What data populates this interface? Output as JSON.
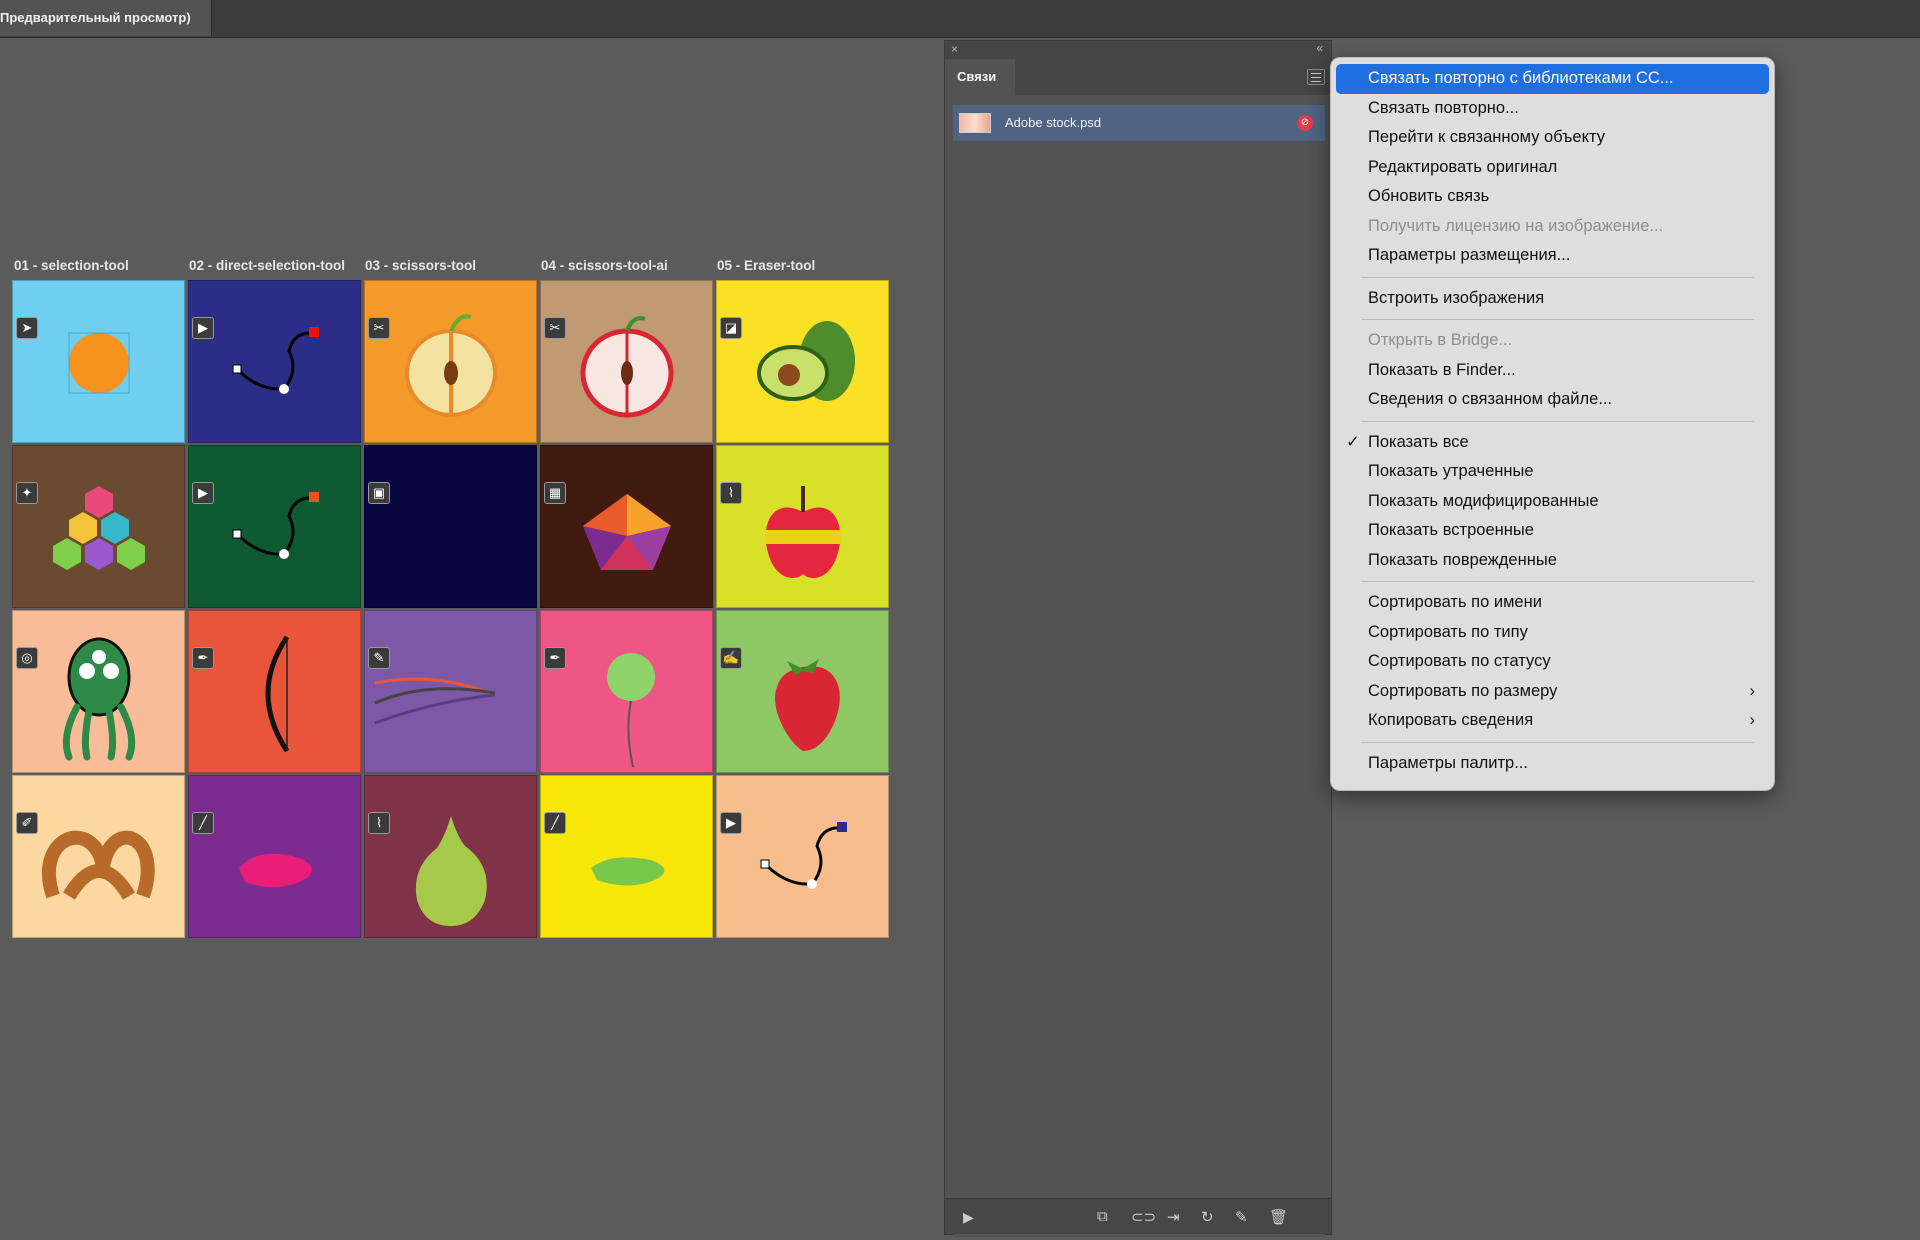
{
  "document_tab": {
    "title": "Предварительный просмотр)"
  },
  "artboards": {
    "column_labels": [
      "01 - selection-tool",
      "02 - direct-selection-tool",
      "03 - scissors-tool",
      "04 - scissors-tool-ai",
      "05 - Eraser-tool"
    ],
    "tiles": [
      {
        "name": "tile-selection-tool",
        "bg": "#6fcff0",
        "icon": "selection-arrow-icon"
      },
      {
        "name": "tile-direct-selection-tool",
        "bg": "#2c2d86",
        "icon": "direct-selection-arrow-icon"
      },
      {
        "name": "tile-scissors-apple-half",
        "bg": "#f39a2b",
        "icon": "scissors-icon"
      },
      {
        "name": "tile-scissors-ai-apple",
        "bg": "#c09a72",
        "icon": "scissors-icon"
      },
      {
        "name": "tile-eraser-avocado",
        "bg": "#fbe126",
        "icon": "eraser-icon"
      },
      {
        "name": "tile-hex-cubes",
        "bg": "#6b4a32",
        "icon": "magic-wand-icon"
      },
      {
        "name": "tile-direct-selection-green",
        "bg": "#0d5a33",
        "icon": "direct-selection-arrow-icon"
      },
      {
        "name": "tile-dark-navy",
        "bg": "#06073f",
        "icon": "gradient-icon"
      },
      {
        "name": "tile-lowpoly-gem",
        "bg": "#421b10",
        "icon": "mesh-icon"
      },
      {
        "name": "tile-eyedropper-apple",
        "bg": "#d8e02a",
        "icon": "eyedropper-icon"
      },
      {
        "name": "tile-octopus",
        "bg": "#f8bd98",
        "icon": "lasso-icon"
      },
      {
        "name": "tile-pen-bow",
        "bg": "#e8553a",
        "icon": "pen-icon"
      },
      {
        "name": "tile-pencil-lines",
        "bg": "#7c58a6",
        "icon": "pencil-icon"
      },
      {
        "name": "tile-balloon",
        "bg": "#ee5685",
        "icon": "pen-icon"
      },
      {
        "name": "tile-strawberry",
        "bg": "#8dc864",
        "icon": "blob-brush-icon"
      },
      {
        "name": "tile-pretzel",
        "bg": "#fcd7a0",
        "icon": "edit-icon"
      },
      {
        "name": "tile-brush-pink",
        "bg": "#7c2c8e",
        "icon": "brush-icon"
      },
      {
        "name": "tile-pear",
        "bg": "#7f3248",
        "icon": "eyedropper-icon"
      },
      {
        "name": "tile-brush-green",
        "bg": "#f9e70a",
        "icon": "brush-icon"
      },
      {
        "name": "tile-direct-selection-peach",
        "bg": "#f8bd8c",
        "icon": "direct-selection-arrow-icon"
      }
    ]
  },
  "links_panel": {
    "tab_label": "Связи",
    "close_glyph": "×",
    "collapse_glyph": "«",
    "items": [
      {
        "filename": "Adobe stock.psd",
        "status_icon": "link-broken-icon"
      }
    ],
    "bottom_icons": [
      "relink-cc-icon",
      "relink-icon",
      "go-to-link-icon",
      "update-link-icon",
      "edit-original-icon",
      "delete-icon"
    ]
  },
  "context_menu": {
    "items": [
      {
        "label": "Связать повторно с библиотеками CC...",
        "state": "highlighted"
      },
      {
        "label": "Связать повторно...",
        "state": "enabled"
      },
      {
        "label": "Перейти к связанному объекту",
        "state": "enabled"
      },
      {
        "label": "Редактировать оригинал",
        "state": "enabled"
      },
      {
        "label": "Обновить связь",
        "state": "enabled"
      },
      {
        "label": "Получить лицензию на изображение...",
        "state": "disabled"
      },
      {
        "label": "Параметры размещения...",
        "state": "enabled"
      },
      {
        "separator": true
      },
      {
        "label": "Встроить изображения",
        "state": "enabled"
      },
      {
        "separator": true
      },
      {
        "label": "Открыть в Bridge...",
        "state": "disabled"
      },
      {
        "label": "Показать в Finder...",
        "state": "enabled"
      },
      {
        "label": "Сведения о связанном файле...",
        "state": "enabled"
      },
      {
        "separator": true
      },
      {
        "label": "Показать все",
        "state": "enabled",
        "checked": true
      },
      {
        "label": "Показать утраченные",
        "state": "enabled"
      },
      {
        "label": "Показать модифицированные",
        "state": "enabled"
      },
      {
        "label": "Показать встроенные",
        "state": "enabled"
      },
      {
        "label": "Показать поврежденные",
        "state": "enabled"
      },
      {
        "separator": true
      },
      {
        "label": "Сортировать по имени",
        "state": "enabled"
      },
      {
        "label": "Сортировать по типу",
        "state": "enabled"
      },
      {
        "label": "Сортировать по статусу",
        "state": "enabled"
      },
      {
        "label": "Сортировать по размеру",
        "state": "enabled",
        "submenu": true
      },
      {
        "label": "Копировать сведения",
        "state": "enabled",
        "submenu": true
      },
      {
        "separator": true
      },
      {
        "label": "Параметры палитр...",
        "state": "enabled"
      }
    ],
    "check_glyph": "✓",
    "submenu_glyph": "›",
    "highlight_color": "#1f6fe0"
  }
}
